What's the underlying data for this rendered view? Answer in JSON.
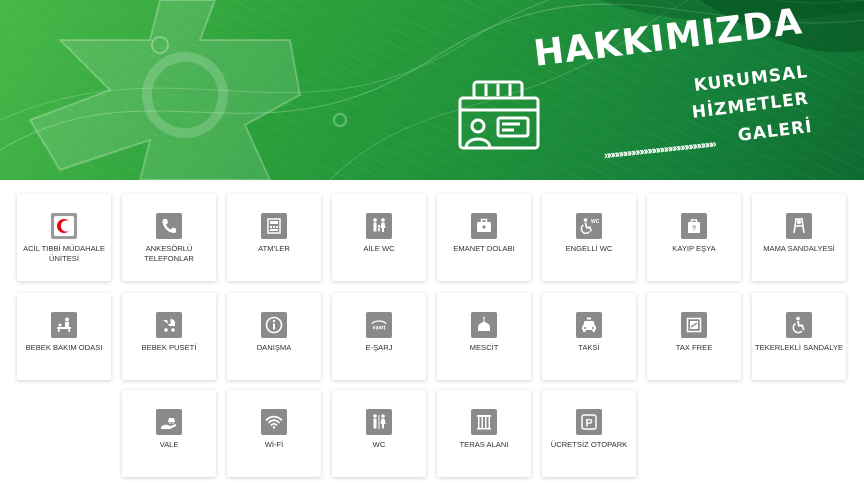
{
  "header": {
    "title": "HAKKIMIZDA",
    "menu": [
      "KURUMSAL",
      "HİZMETLER",
      "GALERİ"
    ],
    "chevrons": "»»»»»»»»»»»»»»»»»»»»»»»»»»»"
  },
  "colors": {
    "banner_start": "#49b849",
    "banner_end": "#0f6b30",
    "icon_bg": "#8a8a8a",
    "red_crescent": "#e30613"
  },
  "services": [
    {
      "label": "ACİL TIBBİ MÜDAHALE ÜNİTESİ",
      "icon": "red-crescent-icon"
    },
    {
      "label": "ANKESÖRLÜ TELEFONLAR",
      "icon": "phone-icon"
    },
    {
      "label": "ATM'LER",
      "icon": "atm-icon"
    },
    {
      "label": "AİLE WC",
      "icon": "family-wc-icon"
    },
    {
      "label": "EMANET DOLABI",
      "icon": "luggage-locker-icon"
    },
    {
      "label": "ENGELLİ WC",
      "icon": "disabled-wc-icon"
    },
    {
      "label": "KAYIP EŞYA",
      "icon": "lost-property-icon"
    },
    {
      "label": "MAMA SANDALYESİ",
      "icon": "high-chair-icon"
    },
    {
      "label": "BEBEK BAKIM ODASI",
      "icon": "baby-care-icon"
    },
    {
      "label": "BEBEK PUSETİ",
      "icon": "stroller-icon"
    },
    {
      "label": "DANIŞMA",
      "icon": "info-icon"
    },
    {
      "label": "E-ŞARJ",
      "icon": "ev-charging-icon"
    },
    {
      "label": "MESCİT",
      "icon": "mosque-icon"
    },
    {
      "label": "TAKSİ",
      "icon": "taxi-icon"
    },
    {
      "label": "TAX FREE",
      "icon": "tax-free-icon"
    },
    {
      "label": "TEKERLEKLİ SANDALYE",
      "icon": "wheelchair-icon"
    },
    {
      "label": "VALE",
      "icon": "valet-icon"
    },
    {
      "label": "Wİ-Fİ",
      "icon": "wifi-icon"
    },
    {
      "label": "WC",
      "icon": "wc-icon"
    },
    {
      "label": "TERAS ALANI",
      "icon": "terrace-icon"
    },
    {
      "label": "ÜCRETSİZ OTOPARK",
      "icon": "parking-icon"
    }
  ],
  "icon_text": {
    "wc": "WC",
    "esarj": "eşarj",
    "parking": "P",
    "lost": "?"
  }
}
